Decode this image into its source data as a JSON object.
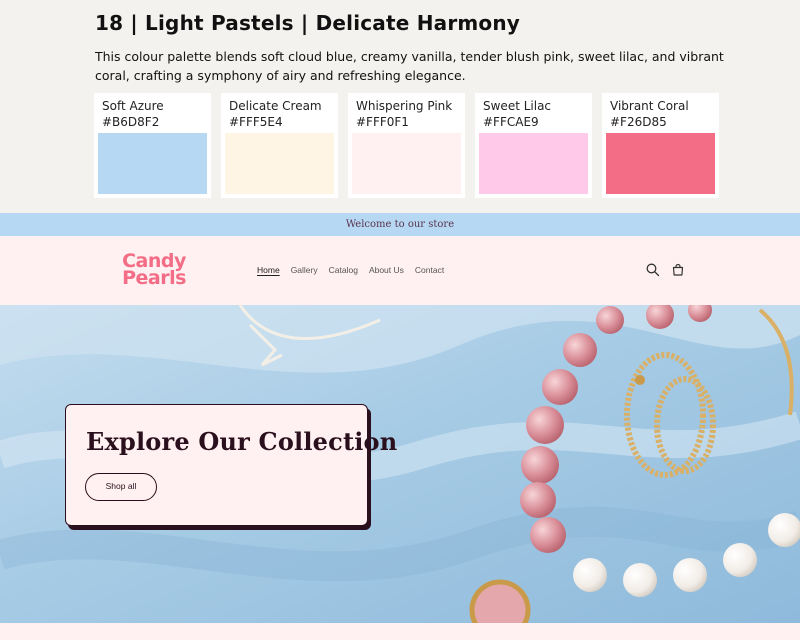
{
  "palette": {
    "title": "18 | Light Pastels | Delicate Harmony",
    "description": "This colour palette blends soft cloud blue, creamy vanilla, tender blush pink, sweet lilac, and vibrant coral, crafting a symphony of airy and refreshing elegance.",
    "swatches": [
      {
        "name": "Soft Azure",
        "hex": "#B6D8F2"
      },
      {
        "name": "Delicate Cream",
        "hex": "#FFF5E4"
      },
      {
        "name": "Whispering Pink",
        "hex": "#FFF0F1"
      },
      {
        "name": "Sweet Lilac",
        "hex": "#FFCAE9"
      },
      {
        "name": "Vibrant Coral",
        "hex": "#F26D85"
      }
    ]
  },
  "announcement": "Welcome to our store",
  "header": {
    "logo_line1": "Candy",
    "logo_line2": "Pearls",
    "nav": [
      "Home",
      "Gallery",
      "Catalog",
      "About Us",
      "Contact"
    ],
    "active_nav": "Home",
    "icons": [
      "search-icon",
      "cart-icon"
    ]
  },
  "hero": {
    "title": "Explore Our Collection",
    "button_label": "Shop all"
  }
}
